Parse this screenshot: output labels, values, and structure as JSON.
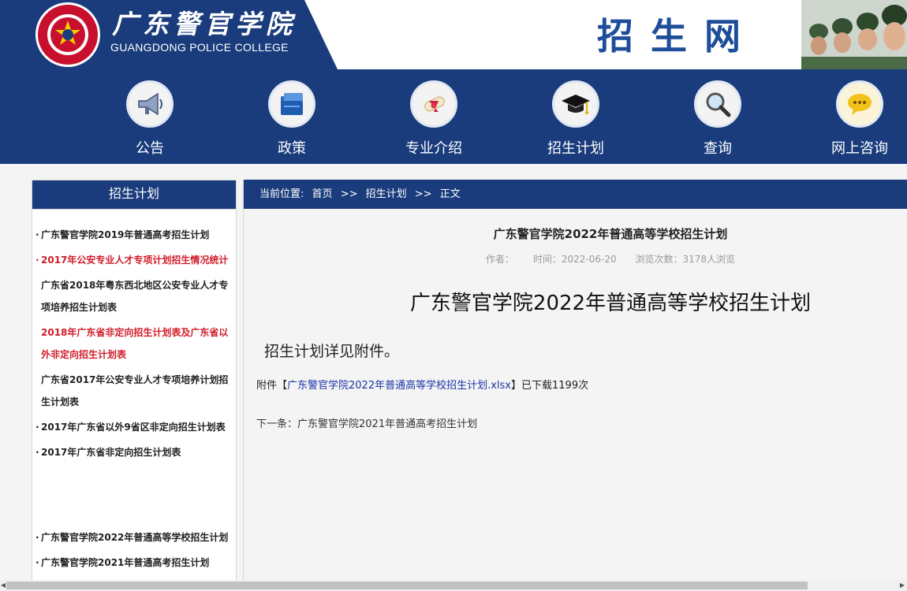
{
  "header": {
    "college_cn": "广东警官学院",
    "college_en": "GUANGDONG POLICE COLLEGE",
    "site_title": "招生网",
    "colors": {
      "navy": "#1a3c7c",
      "brand_blue": "#1e4d9a",
      "seal_red": "#c8102e"
    }
  },
  "nav": [
    {
      "label": "公告",
      "icon": "megaphone-icon"
    },
    {
      "label": "政策",
      "icon": "folder-icon"
    },
    {
      "label": "专业介绍",
      "icon": "diploma-icon"
    },
    {
      "label": "招生计划",
      "icon": "graduation-cap-icon"
    },
    {
      "label": "查询",
      "icon": "magnifier-icon"
    },
    {
      "label": "网上咨询",
      "icon": "chat-bubble-icon"
    }
  ],
  "sidebar": {
    "title": "招生计划",
    "items": [
      {
        "text": "广东警官学院2019年普通高考招生计划",
        "bullet": "·",
        "red": false
      },
      {
        "text": "2017年公安专业人才专项计划招生情况统计",
        "bullet": "·",
        "red": true
      },
      {
        "text": "广东省2018年粤东西北地区公安专业人才专项培养招生计划表",
        "bullet": "",
        "red": false
      },
      {
        "text": "2018年广东省非定向招生计划表及广东省以外非定向招生计划表",
        "bullet": "",
        "red": true
      },
      {
        "text": "广东省2017年公安专业人才专项培养计划招生计划表",
        "bullet": "",
        "red": false
      },
      {
        "text": "2017年广东省以外9省区非定向招生计划表",
        "bullet": "·",
        "red": false
      },
      {
        "text": "2017年广东省非定向招生计划表",
        "bullet": "·",
        "red": false
      },
      {
        "text": "广东警官学院2022年普通高等学校招生计划",
        "bullet": "·",
        "red": false
      },
      {
        "text": "广东警官学院2021年普通高考招生计划",
        "bullet": "·",
        "red": false
      }
    ]
  },
  "breadcrumb": {
    "label": "当前位置:",
    "home": "首页",
    "sep": ">>",
    "section": "招生计划",
    "current": "正文"
  },
  "article": {
    "title": "广东警官学院2022年普通高等学校招生计划",
    "author": "作者：",
    "time": "时间：2022-06-20",
    "views": "浏览次数：3178人浏览",
    "big_title": "广东警官学院2022年普通高等学校招生计划",
    "paragraph": "招生计划详见附件。",
    "attach_prefix": "附件【",
    "attach_link": "广东警官学院2022年普通高等学校招生计划.xlsx",
    "attach_suffix": "】已下载1199次",
    "next": "下一条：广东警官学院2021年普通高考招生计划"
  }
}
